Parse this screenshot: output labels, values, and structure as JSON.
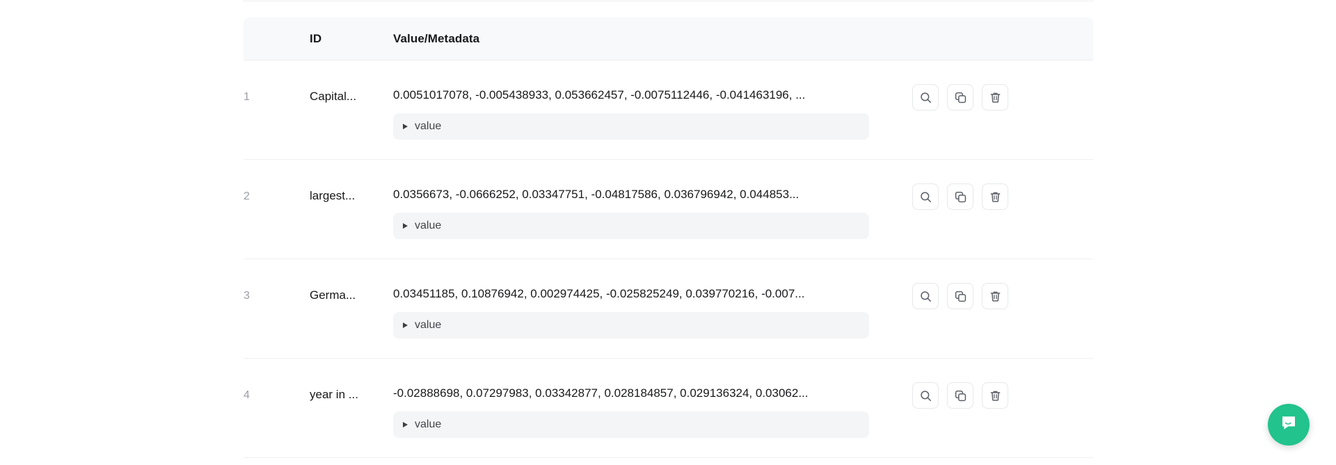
{
  "table": {
    "columns": {
      "index": "",
      "id": "ID",
      "value": "Value/Metadata",
      "actions": ""
    },
    "rows": [
      {
        "index": "1",
        "id": "Capital...",
        "value": "0.0051017078, -0.005438933, 0.053662457, -0.0075112446, -0.041463196, ...",
        "metadata_label": "value"
      },
      {
        "index": "2",
        "id": "largest...",
        "value": "0.0356673, -0.0666252, 0.03347751, -0.04817586, 0.036796942, 0.044853...",
        "metadata_label": "value"
      },
      {
        "index": "3",
        "id": "Germa...",
        "value": "0.03451185, 0.10876942, 0.002974425, -0.025825249, 0.039770216, -0.007...",
        "metadata_label": "value"
      },
      {
        "index": "4",
        "id": "year in ...",
        "value": "-0.02888698, 0.07297983, 0.03342877, 0.028184857, 0.029136324, 0.03062...",
        "metadata_label": "value"
      }
    ],
    "row_actions": {
      "inspect": "search-icon",
      "copy": "copy-icon",
      "delete": "trash-icon"
    }
  },
  "support_widget": {
    "icon": "chat-bubble-icon",
    "color": "#22c38c"
  },
  "colors": {
    "header_bg": "#f8f9fa",
    "divider": "#eff0f2",
    "text": "#18191b",
    "muted": "#9a9ea5",
    "panel_bg": "#f4f5f6"
  }
}
